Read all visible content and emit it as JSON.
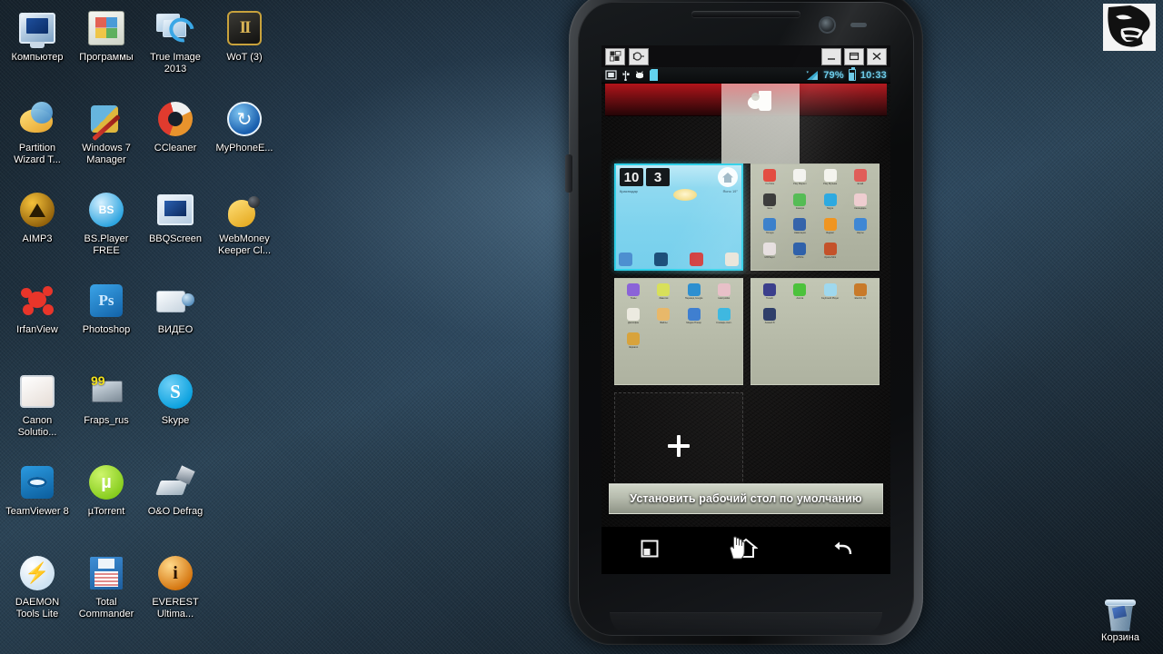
{
  "desktop": {
    "icons": [
      {
        "label": "Компьютер",
        "icon": "computer-icon",
        "art": "ic-monitor"
      },
      {
        "label": "Программы",
        "icon": "programs-folder-icon",
        "art": "ic-folderwin"
      },
      {
        "label": "True Image 2013",
        "icon": "true-image-icon",
        "art": "ic-trueimage"
      },
      {
        "label": "WoT (3)",
        "icon": "world-of-tanks-icon",
        "art": "ic-wot"
      },
      {
        "label": "Partition Wizard T...",
        "icon": "partition-wizard-icon",
        "art": "ic-partition"
      },
      {
        "label": "Windows 7 Manager",
        "icon": "windows7-manager-icon",
        "art": "ic-win7mgr"
      },
      {
        "label": "CCleaner",
        "icon": "ccleaner-icon",
        "art": "ic-ccleaner"
      },
      {
        "label": "MyPhoneE...",
        "icon": "myphoneexplorer-icon",
        "art": "ic-myphone"
      },
      {
        "label": "AIMP3",
        "icon": "aimp3-icon",
        "art": "ic-aimp"
      },
      {
        "label": "BS.Player FREE",
        "icon": "bsplayer-icon",
        "art": "ic-bsplayer"
      },
      {
        "label": "BBQScreen",
        "icon": "bbqscreen-icon",
        "art": "ic-bbq"
      },
      {
        "label": "WebMoney Keeper Cl...",
        "icon": "webmoney-icon",
        "art": "ic-webmoney"
      },
      {
        "label": "IrfanView",
        "icon": "irfanview-icon",
        "art": "ic-irfan"
      },
      {
        "label": "Photoshop",
        "icon": "photoshop-icon",
        "art": "ic-ps"
      },
      {
        "label": "ВИДЕО",
        "icon": "video-folder-icon",
        "art": "ic-video"
      },
      {
        "label": "",
        "icon": "empty-slot",
        "art": "ic-none"
      },
      {
        "label": "Canon Solutio...",
        "icon": "canon-solution-icon",
        "art": "ic-canon"
      },
      {
        "label": "Fraps_rus",
        "icon": "fraps-icon",
        "art": "ic-fraps"
      },
      {
        "label": "Skype",
        "icon": "skype-icon",
        "art": "ic-skype"
      },
      {
        "label": "",
        "icon": "empty-slot",
        "art": "ic-none"
      },
      {
        "label": "TeamViewer 8",
        "icon": "teamviewer-icon",
        "art": "ic-teamviewer"
      },
      {
        "label": "µTorrent",
        "icon": "utorrent-icon",
        "art": "ic-utorrent"
      },
      {
        "label": "O&O Defrag",
        "icon": "oo-defrag-icon",
        "art": "ic-oodefrag"
      },
      {
        "label": "",
        "icon": "empty-slot",
        "art": "ic-none"
      },
      {
        "label": "DAEMON Tools Lite",
        "icon": "daemon-tools-icon",
        "art": "ic-daemon"
      },
      {
        "label": "Total Commander",
        "icon": "total-commander-icon",
        "art": "ic-totalcmd"
      },
      {
        "label": "EVEREST Ultima...",
        "icon": "everest-icon",
        "art": "ic-everest"
      },
      {
        "label": "",
        "icon": "empty-slot",
        "art": "ic-none"
      }
    ],
    "recycle_bin": {
      "label": "Корзина",
      "icon": "recycle-bin-icon"
    }
  },
  "window": {
    "toolbar_left": [
      {
        "name": "layout-windows-icon",
        "title": "Layout"
      },
      {
        "name": "connection-plug-icon",
        "title": "Connect"
      }
    ],
    "controls": [
      {
        "name": "minimize-button",
        "glyph": "minimize"
      },
      {
        "name": "maximize-button",
        "glyph": "maximize"
      },
      {
        "name": "close-button",
        "glyph": "close"
      }
    ]
  },
  "status_bar": {
    "left_icons": [
      "screenshot-icon",
      "usb-icon",
      "android-robot-icon",
      "sdcard-icon"
    ],
    "signal_icon": "signal-bars-icon",
    "battery_percent": "79%",
    "battery_icon": "battery-icon",
    "clock": "10:33"
  },
  "editor": {
    "delete_target": {
      "icon": "trash-icon",
      "state": "highlighted"
    },
    "screens": [
      {
        "id": "screen-1",
        "type": "clock-widget",
        "selected": true,
        "clock_hour": "10",
        "clock_minute": "3",
        "home_badge": "home-indicator-icon",
        "weather_left": "Краснодар",
        "weather_right": "Ясно 19°",
        "dock": [
          "gallery-icon",
          "browser-icon",
          "phone-icon",
          "camera-icon"
        ]
      },
      {
        "id": "screen-2",
        "type": "app-grid",
        "selected": false,
        "apps": [
          {
            "label": "YouTube",
            "color": "#e03a2e"
          },
          {
            "label": "Play Маркет",
            "color": "#f2f2ee"
          },
          {
            "label": "Play Музыка",
            "color": "#f4f4ee"
          },
          {
            "label": "Email",
            "color": "#e05c57"
          },
          {
            "label": "Часы",
            "color": "#2c2c2c"
          },
          {
            "label": "Камера",
            "color": "#4eb94e"
          },
          {
            "label": "Skype",
            "color": "#2aa8e0"
          },
          {
            "label": "Календарь",
            "color": "#eecdd0"
          },
          {
            "label": "Погода",
            "color": "#2f78c8"
          },
          {
            "label": "Навигация",
            "color": "#2f5fa8"
          },
          {
            "label": "Яндекс",
            "color": "#f0941e"
          },
          {
            "label": "Карты",
            "color": "#3f87d4"
          },
          {
            "label": "MXPlayer",
            "color": "#e6dede"
          },
          {
            "label": "ePSXe",
            "color": "#2b5ea8"
          },
          {
            "label": "Opera Mini",
            "color": "#c4522a"
          }
        ]
      },
      {
        "id": "screen-3",
        "type": "app-grid",
        "selected": false,
        "apps": [
          {
            "label": "Темы",
            "color": "#8b63d8"
          },
          {
            "label": "Заметки",
            "color": "#d8e05a"
          },
          {
            "label": "Перевод Google",
            "color": "#2d8fd0"
          },
          {
            "label": "Настройки",
            "color": "#e8c0c8"
          },
          {
            "label": "Диктофон",
            "color": "#eceae0"
          },
          {
            "label": "Файлы",
            "color": "#e8b86a"
          },
          {
            "label": "Медиа Плеер",
            "color": "#3f7fd0"
          },
          {
            "label": "Словарь Англ.",
            "color": "#3fb8e0"
          },
          {
            "label": "Зеркало",
            "color": "#d8a33c"
          }
        ]
      },
      {
        "id": "screen-4",
        "type": "app-grid",
        "selected": false,
        "apps": [
          {
            "label": "TuneIn",
            "color": "#3b3f8c"
          },
          {
            "label": "Aurora",
            "color": "#4cc23c"
          },
          {
            "label": "Keyboard Player",
            "color": "#9fd8ee"
          },
          {
            "label": "Electric Up",
            "color": "#c87a2a"
          },
          {
            "label": "Assault 8",
            "color": "#2f3f6a"
          }
        ]
      },
      {
        "id": "screen-add",
        "type": "add",
        "selected": false,
        "add_icon": "plus-icon"
      }
    ],
    "default_button_label": "Установить рабочий стол по умолчанию"
  },
  "nav_bar": {
    "buttons": [
      {
        "name": "recent-apps-button",
        "icon": "recent-apps-icon"
      },
      {
        "name": "home-button",
        "icon": "home-icon"
      },
      {
        "name": "back-button",
        "icon": "back-arrow-icon"
      }
    ],
    "cursor": "hand-cursor-icon"
  },
  "overlay": {
    "corner_image": "rage-face-image"
  },
  "colors": {
    "accent_cyan": "#2fd0e8",
    "status_text": "#6ecbe8",
    "delete_red": "#b2141a",
    "desktop_blue": "#2b4457"
  }
}
